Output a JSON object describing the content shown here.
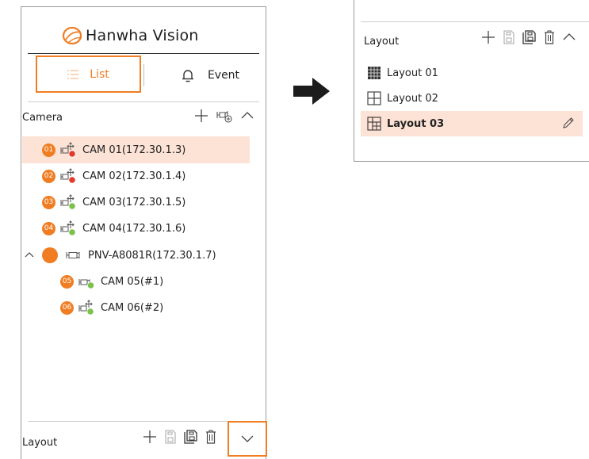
{
  "brand": {
    "name": "Hanwha Vision"
  },
  "colors": {
    "accent": "#f07d22",
    "selected_bg": "#fde2d6",
    "rec_red": "#e23a2b",
    "live_green": "#7ac24a"
  },
  "tabs": [
    {
      "label": "List",
      "icon": "list-icon",
      "active": true
    },
    {
      "label": "Event",
      "icon": "bell-icon",
      "active": false
    }
  ],
  "camera_section": {
    "title": "Camera",
    "tools": [
      "add-icon",
      "add-camera-icon",
      "chevron-up-icon"
    ],
    "cameras": [
      {
        "number": "01",
        "label": "CAM 01(172.30.1.3)",
        "icon": "ptz-camera-icon",
        "status": "red",
        "selected": true
      },
      {
        "number": "02",
        "label": "CAM 02(172.30.1.4)",
        "icon": "ptz-camera-icon",
        "status": "red",
        "selected": false
      },
      {
        "number": "03",
        "label": "CAM 03(172.30.1.5)",
        "icon": "ptz-camera-icon",
        "status": "green",
        "selected": false
      },
      {
        "number": "04",
        "label": "CAM 04(172.30.1.6)",
        "icon": "ptz-camera-icon",
        "status": "green",
        "selected": false
      }
    ],
    "group": {
      "label": "PNV-A8081R(172.30.1.7)",
      "expanded": true
    },
    "group_children": [
      {
        "number": "05",
        "label": "CAM 05(#1)",
        "icon": "camera-icon",
        "status": "green"
      },
      {
        "number": "06",
        "label": "CAM 06(#2)",
        "icon": "ptz-camera-icon",
        "status": "green"
      }
    ]
  },
  "layout_section_collapsed": {
    "title": "Layout",
    "tools": [
      "add-icon",
      "save-icon",
      "save-as-icon",
      "delete-icon",
      "chevron-down-icon"
    ]
  },
  "layout_section_expanded": {
    "title": "Layout",
    "tools": [
      "add-icon",
      "save-icon",
      "save-as-icon",
      "delete-icon",
      "chevron-up-icon"
    ],
    "layouts": [
      {
        "label": "Layout 01",
        "icon": "grid-16-icon",
        "selected": false
      },
      {
        "label": "Layout 02",
        "icon": "grid-4-icon",
        "selected": false
      },
      {
        "label": "Layout 03",
        "icon": "grid-custom-icon",
        "selected": true
      }
    ]
  }
}
